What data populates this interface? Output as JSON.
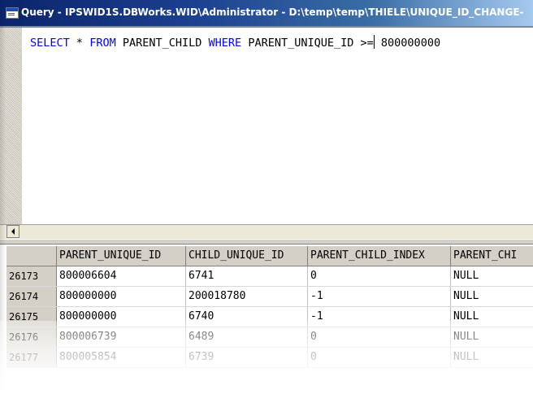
{
  "window": {
    "title": "Query - IPSWID1S.DBWorks.WID\\Administrator - D:\\temp\\temp\\THIELE\\UNIQUE_ID_CHANGE-"
  },
  "editor": {
    "kw_select": "SELECT",
    "star": "*",
    "kw_from": "FROM",
    "table": "PARENT_CHILD",
    "kw_where": "WHERE",
    "column": "PARENT_UNIQUE_ID",
    "operator": ">=",
    "value": "800000000"
  },
  "results": {
    "columns": [
      "",
      "PARENT_UNIQUE_ID",
      "CHILD_UNIQUE_ID",
      "PARENT_CHILD_INDEX",
      "PARENT_CHI"
    ],
    "rows": [
      [
        "26173",
        "800006604",
        "6741",
        "0",
        "NULL"
      ],
      [
        "26174",
        "800000000",
        "200018780",
        "-1",
        "NULL"
      ],
      [
        "26175",
        "800000000",
        "6740",
        "-1",
        "NULL"
      ],
      [
        "26176",
        "800006739",
        "6489",
        "0",
        "NULL"
      ],
      [
        "26177",
        "800005854",
        "6739",
        "0",
        "NULL"
      ]
    ]
  }
}
